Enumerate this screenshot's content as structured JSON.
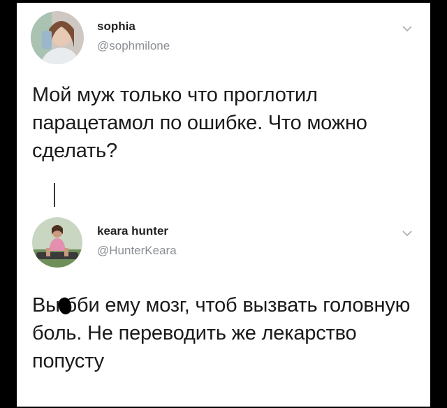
{
  "tweets": [
    {
      "username": "sophia",
      "handle": "@sophmilone",
      "text": "Мой муж только что проглотил парацетамол по ошибке. Что можно сделать?",
      "avatar_icon": "user-avatar-photo"
    },
    {
      "username": "keara hunter",
      "handle": "@HunterKeara",
      "text": "Вы бби ему мозг, чтоб вызвать головную боль. Не переводить же лекарство попусту",
      "avatar_icon": "user-avatar-photo"
    }
  ],
  "icons": {
    "menu": "chevron-down-icon"
  },
  "colors": {
    "background": "#000000",
    "card": "#ffffff",
    "handle": "#8a8f94",
    "text": "#1a1a1a"
  }
}
